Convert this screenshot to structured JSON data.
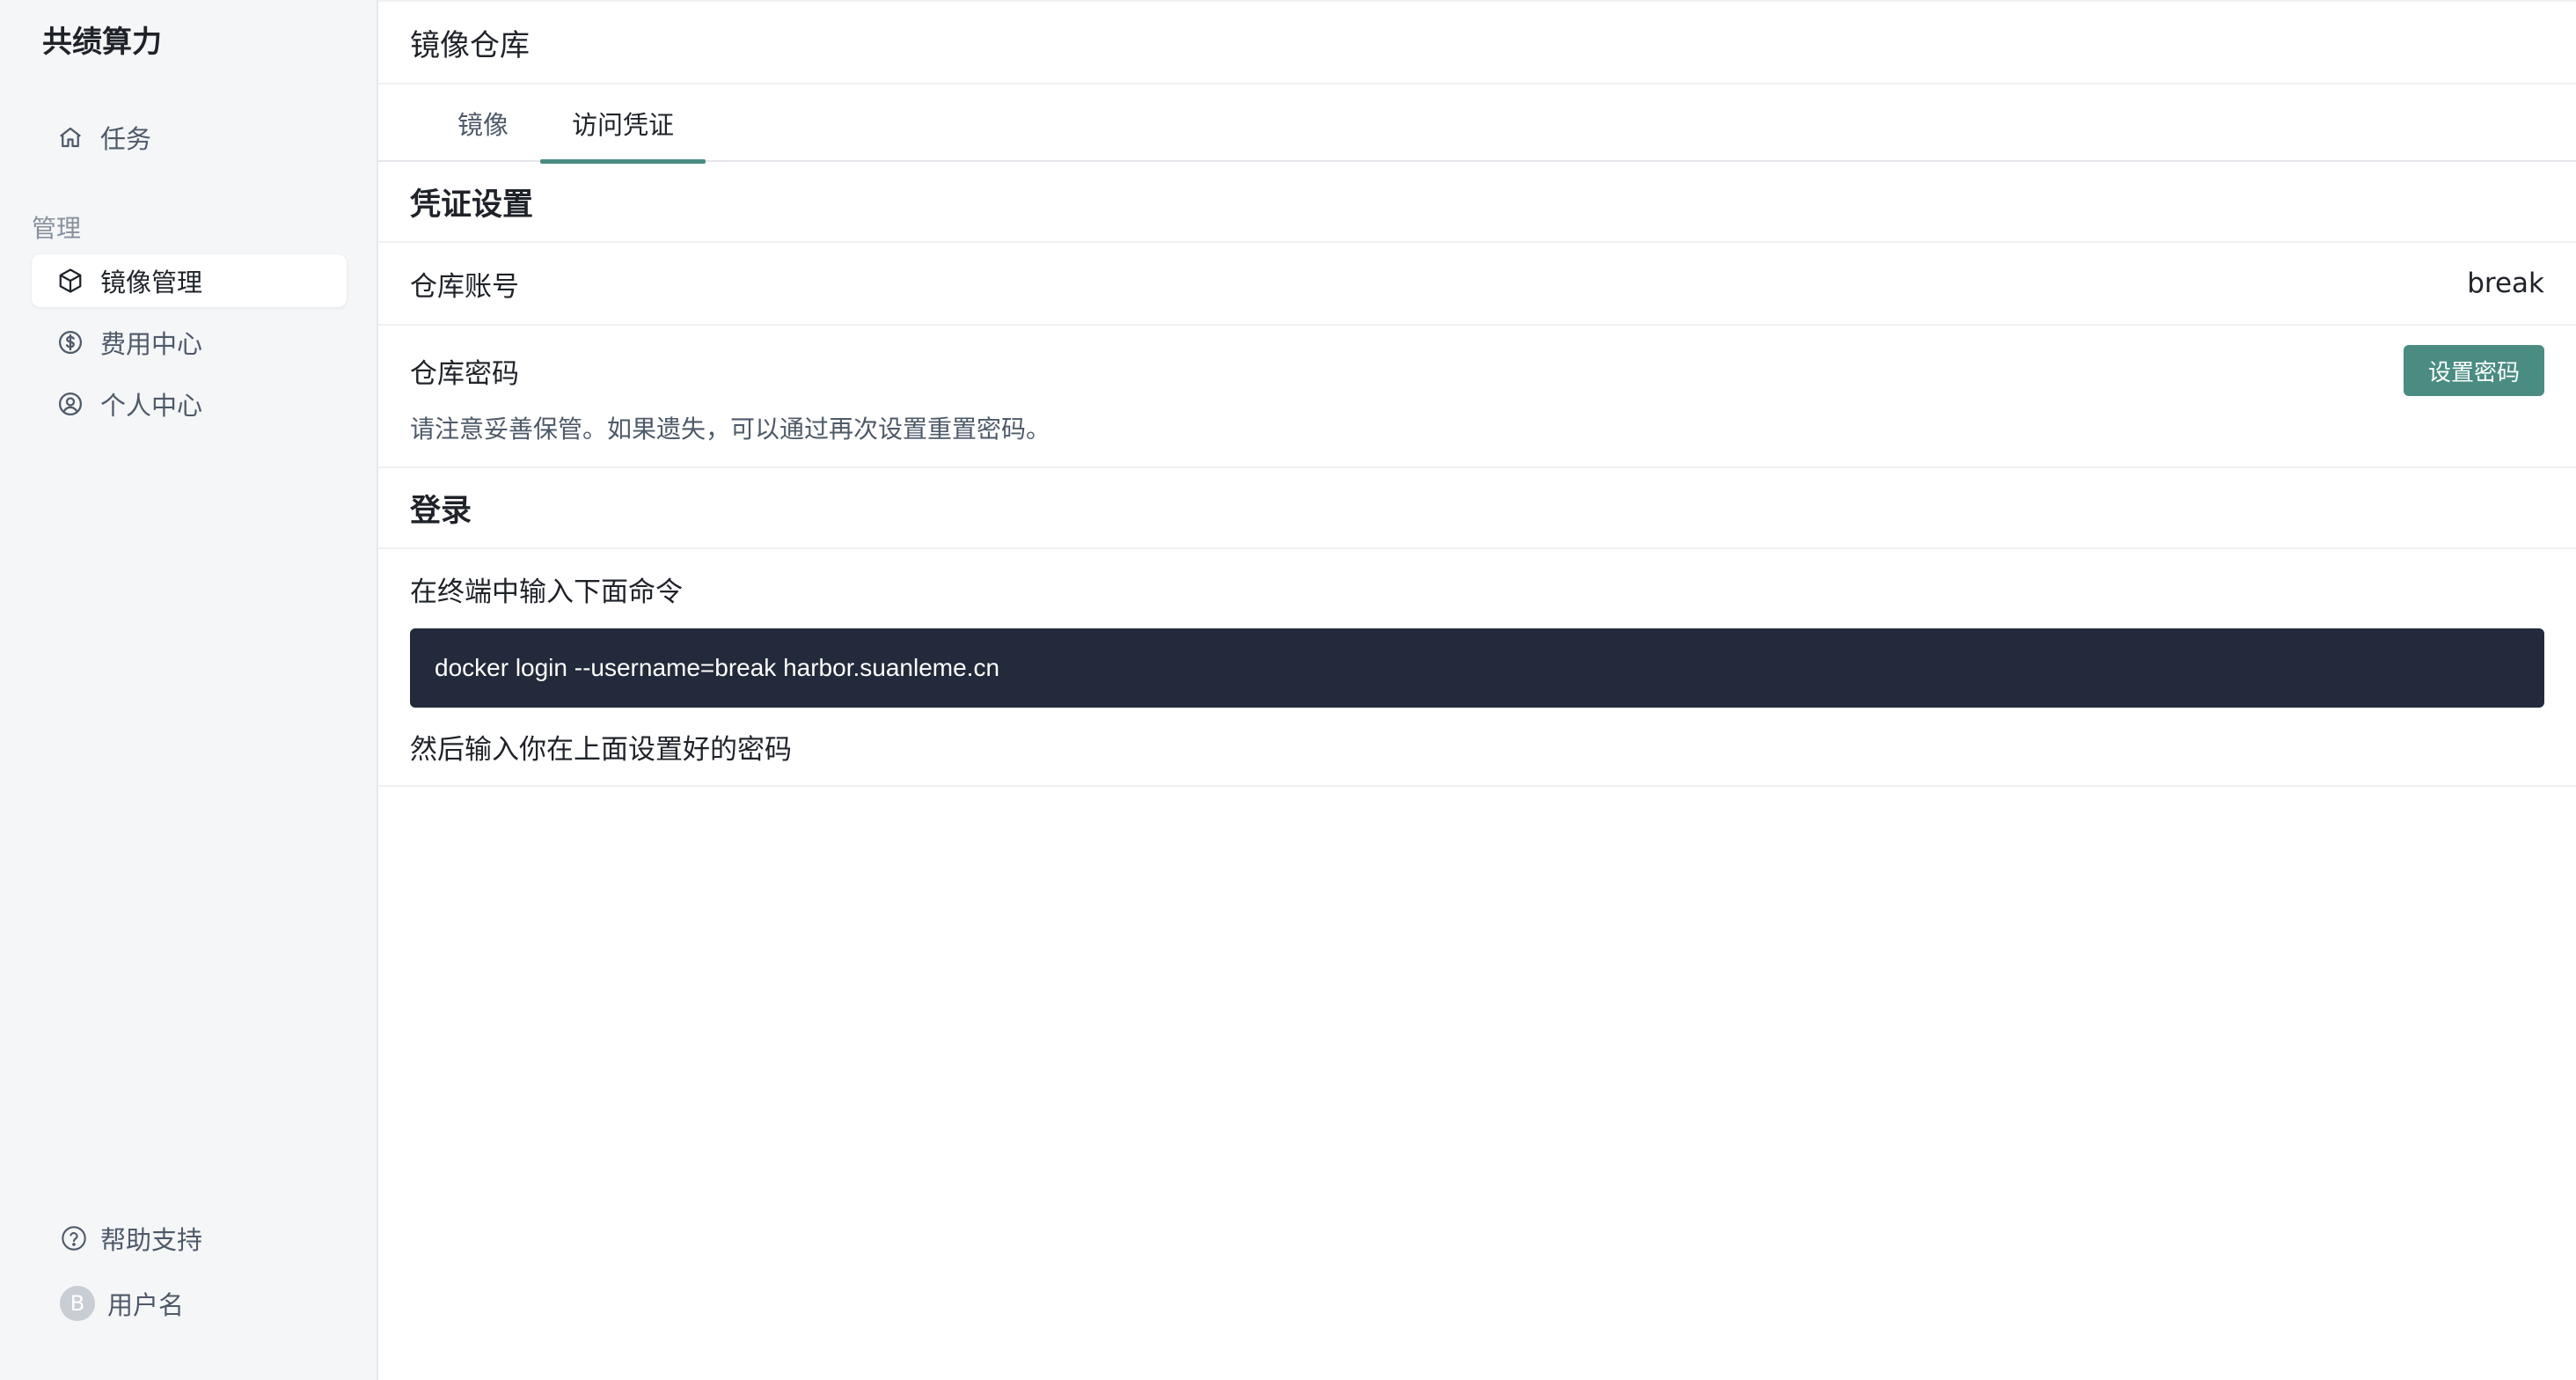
{
  "sidebar": {
    "brand": "共绩算力",
    "top_items": [
      {
        "label": "任务",
        "icon": "home-icon"
      }
    ],
    "section_label": "管理",
    "items": [
      {
        "label": "镜像管理",
        "icon": "box-icon",
        "active": true
      },
      {
        "label": "费用中心",
        "icon": "dollar-icon"
      },
      {
        "label": "个人中心",
        "icon": "user-circle-icon"
      }
    ],
    "footer": {
      "help": "帮助支持",
      "avatar_letter": "B",
      "username": "用户名"
    }
  },
  "header": {
    "title": "镜像仓库"
  },
  "tabs": [
    {
      "label": "镜像",
      "active": false
    },
    {
      "label": "访问凭证",
      "active": true
    }
  ],
  "credentials": {
    "section_title": "凭证设置",
    "account_label": "仓库账号",
    "account_value": "break",
    "password_label": "仓库密码",
    "set_password_button": "设置密码",
    "hint": "请注意妥善保管。如果遗失，可以通过再次设置重置密码。"
  },
  "login": {
    "section_title": "登录",
    "instruction": "在终端中输入下面命令",
    "command": "docker login --username=break harbor.suanleme.cn",
    "after": "然后输入你在上面设置好的密码"
  },
  "colors": {
    "accent": "#4a8c82",
    "code_bg": "#232a3b",
    "sidebar_bg": "#f5f6f8"
  }
}
